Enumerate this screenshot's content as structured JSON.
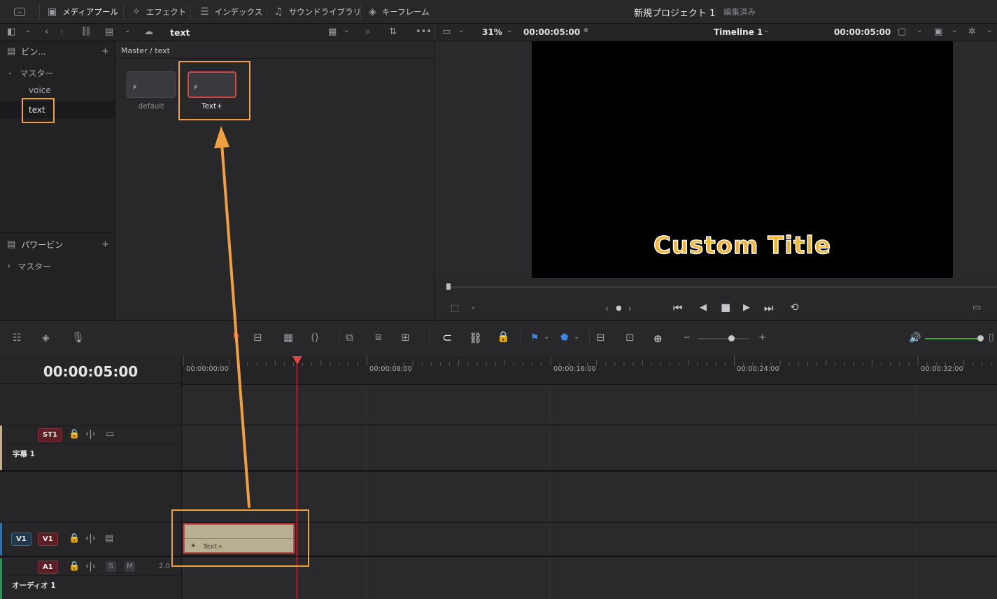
{
  "topbar": {
    "media_pool": "メディアプール",
    "effects": "エフェクト",
    "index": "インデックス",
    "sound_library": "サウンドライブラリ",
    "keyframes": "キーフレーム",
    "project_title": "新規プロジェクト 1",
    "project_status": "編集済み"
  },
  "row2": {
    "bin_name": "text",
    "zoom": "31%",
    "source_timecode": "00:00:05:00",
    "timeline_name": "Timeline 1",
    "program_timecode": "00:00:05:00"
  },
  "bins": {
    "header": "ビン...",
    "master": "マスター",
    "items": [
      "voice",
      "text"
    ],
    "power_bins": "パワービン",
    "power_master": "マスター"
  },
  "media": {
    "breadcrumb": "Master / text",
    "clips": [
      "default",
      "Text+"
    ]
  },
  "viewer": {
    "title_text": "Custom Title"
  },
  "timeline": {
    "timecode": "00:00:05:00",
    "ruler": [
      "00:00:00:00",
      "00:00:08:00",
      "00:00:16:00",
      "00:00:24:00",
      "00:00:32:00"
    ],
    "tracks": {
      "st1_badge": "ST1",
      "st1_name": "字幕 1",
      "v1_dest": "V1",
      "v1_badge": "V1",
      "a1_badge": "A1",
      "a1_solo": "S",
      "a1_mute": "M",
      "a1_level": "2.0",
      "a1_name": "オーディオ 1"
    },
    "clip_label": "Text+"
  },
  "colors": {
    "highlight": "#f0a040",
    "playhead": "#e04040",
    "clip": "#b9b094",
    "volume": "#3ca83c"
  }
}
